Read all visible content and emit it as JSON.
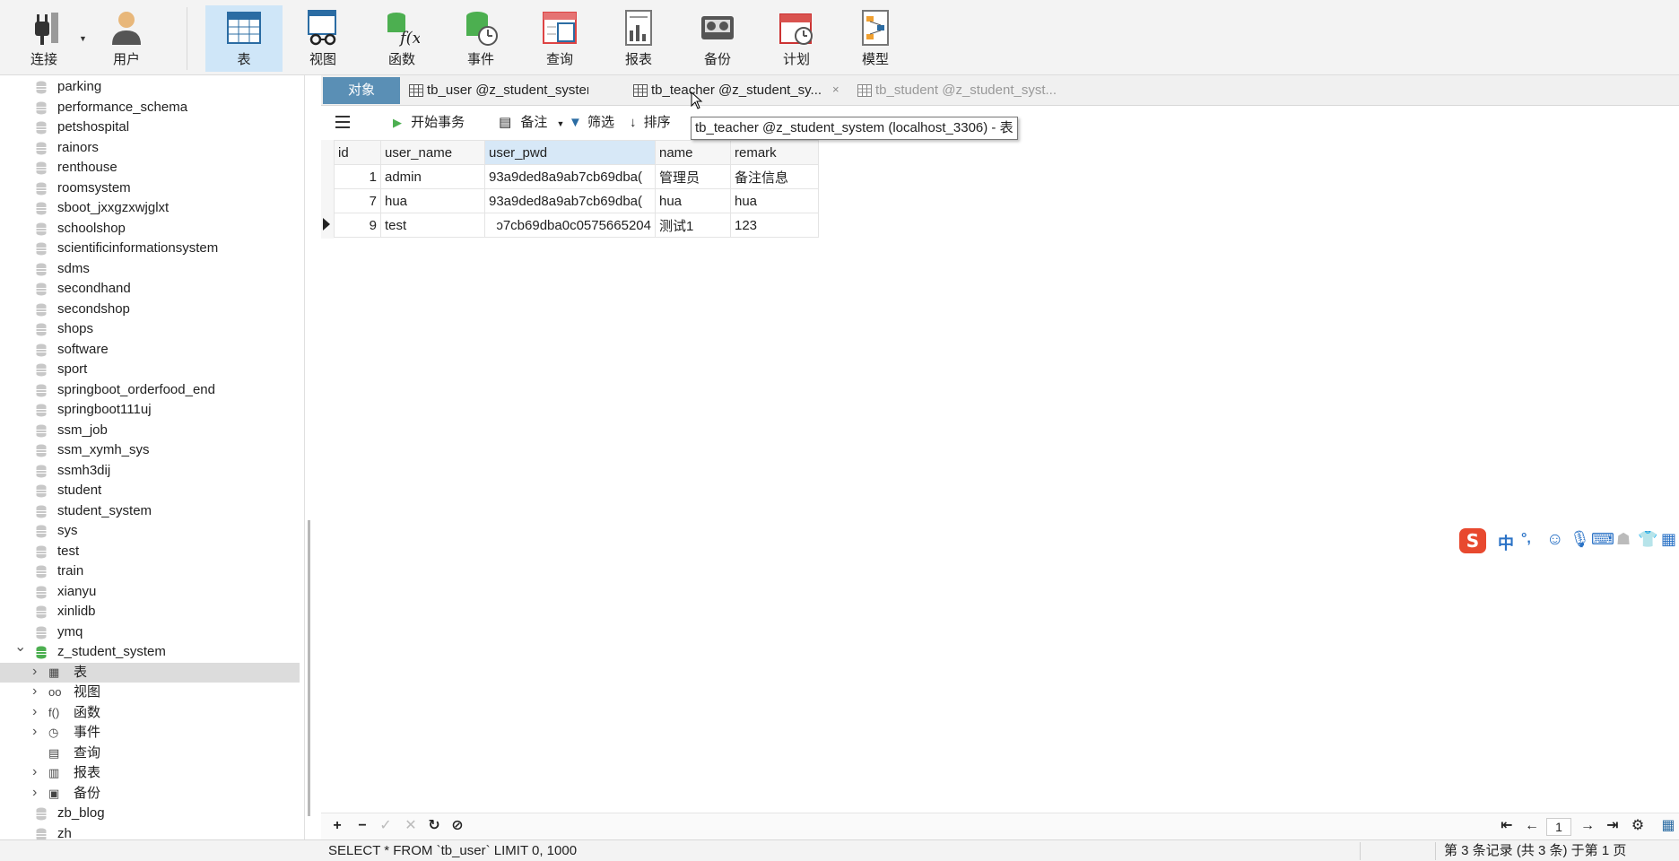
{
  "toolbar": {
    "items": [
      {
        "label": "连接",
        "icon": "plug-icon"
      },
      {
        "label": "用户",
        "icon": "user-icon"
      },
      {
        "label": "表",
        "icon": "table-icon",
        "active": true
      },
      {
        "label": "视图",
        "icon": "view-glasses-icon"
      },
      {
        "label": "函数",
        "icon": "function-icon"
      },
      {
        "label": "事件",
        "icon": "event-clock-icon"
      },
      {
        "label": "查询",
        "icon": "query-icon"
      },
      {
        "label": "报表",
        "icon": "report-icon"
      },
      {
        "label": "备份",
        "icon": "backup-icon"
      },
      {
        "label": "计划",
        "icon": "schedule-calendar-icon"
      },
      {
        "label": "模型",
        "icon": "model-icon"
      }
    ]
  },
  "sidebar": {
    "databases": [
      "parking",
      "performance_schema",
      "petshospital",
      "rainors",
      "renthouse",
      "roomsystem",
      "sboot_jxxgzxwjglxt",
      "schoolshop",
      "scientificinformationsystem",
      "sdms",
      "secondhand",
      "secondshop",
      "shops",
      "software",
      "sport",
      "springboot_orderfood_end",
      "springboot111uj",
      "ssm_job",
      "ssm_xymh_sys",
      "ssmh3dij",
      "student",
      "student_system",
      "sys",
      "test",
      "train",
      "xianyu",
      "xinlidb",
      "ymq"
    ],
    "open_db": "z_student_system",
    "children": [
      {
        "label": "表",
        "icon": "table-icon",
        "expandable": true
      },
      {
        "label": "视图",
        "icon": "view-glasses-icon",
        "expandable": true
      },
      {
        "label": "函数",
        "icon": "function-icon",
        "expandable": true
      },
      {
        "label": "事件",
        "icon": "event-clock-icon",
        "expandable": true
      },
      {
        "label": "查询",
        "icon": "query-icon",
        "expandable": false
      },
      {
        "label": "报表",
        "icon": "report-icon",
        "expandable": true
      },
      {
        "label": "备份",
        "icon": "backup-icon",
        "expandable": true
      }
    ],
    "after": [
      "zb_blog",
      "zh"
    ]
  },
  "tabs": {
    "objects": "对象",
    "items": [
      {
        "label": "tb_user @z_student_system ..."
      },
      {
        "label": "tb_teacher @z_student_sy...",
        "close": "×"
      },
      {
        "label": "tb_student @z_student_syst..."
      }
    ]
  },
  "grid_toolbar": {
    "begin_tx": "开始事务",
    "note": "备注",
    "filter": "筛选",
    "sort": "排序"
  },
  "tooltip": "tb_teacher @z_student_system (localhost_3306) - 表",
  "table": {
    "columns": [
      "id",
      "user_name",
      "user_pwd",
      "name",
      "remark"
    ],
    "rows": [
      [
        "1",
        "admin",
        "93a9ded8a9ab7cb69dba(",
        "管理员",
        "备注信息"
      ],
      [
        "7",
        "hua",
        "93a9ded8a9ab7cb69dba(",
        "hua",
        "hua"
      ],
      [
        "9",
        "test",
        "ɔ7cb69dba0c0575665204",
        "测试1",
        "123"
      ]
    ]
  },
  "bottom_bar": {
    "page": "1"
  },
  "status": {
    "sql": "SELECT * FROM `tb_user` LIMIT 0, 1000",
    "records": "第 3 条记录 (共 3 条) 于第 1 页"
  },
  "ime": {
    "items": [
      "中",
      "°,"
    ]
  },
  "colors": {
    "tab_active": "#5a8fb5",
    "toolbar_active": "#cfe6f8",
    "selected_row": "#dcdcdc",
    "db_icon": "#c8c8c8",
    "db_icon_open": "#4caf50",
    "ime_red": "#e8492f",
    "ime_blue": "#2a72c6"
  }
}
